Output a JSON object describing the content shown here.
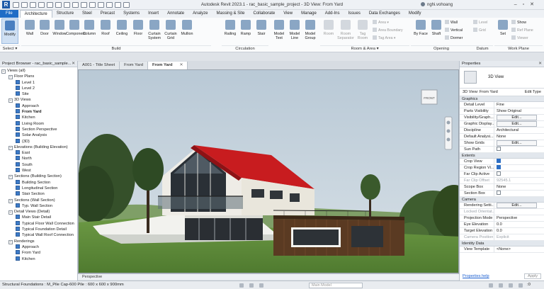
{
  "app_title": "Autodesk Revit 2023.1 - rac_basic_sample_project - 3D View: From Yard",
  "user_name": "nghi.vohoang",
  "ribbon_tabs": [
    "File",
    "Architecture",
    "Structure",
    "Steel",
    "Precast",
    "Systems",
    "Insert",
    "Annotate",
    "Analyze",
    "Massing & Site",
    "Collaborate",
    "View",
    "Manage",
    "Add-Ins",
    "Issues",
    "Data Exchanges",
    "Modify"
  ],
  "active_tab": "Architecture",
  "ribbon": {
    "select": {
      "modify": "Modify",
      "label": "Select ▾"
    },
    "build_buttons": [
      "Wall",
      "Door",
      "Window",
      "Component",
      "Column",
      "Roof",
      "Ceiling",
      "Floor",
      "Curtain System",
      "Curtain Grid",
      "Mullion"
    ],
    "build_label": "Build",
    "circulation_buttons": [
      "Railing",
      "Ramp",
      "Stair"
    ],
    "circulation_label": "Circulation",
    "model_buttons": [
      "Model Text",
      "Model Line",
      "Model Group"
    ],
    "room_buttons": [
      "Room",
      "Room Separator",
      "Tag Room"
    ],
    "area_items": [
      "Area ▾",
      "Area Boundary",
      "Tag Area ▾"
    ],
    "room_label": "Room & Area ▾",
    "opening_buttons": [
      "By Face",
      "Shaft"
    ],
    "opening_small": [
      "Wall",
      "Vertical",
      "Dormer"
    ],
    "opening_label": "Opening",
    "datum_items": [
      "Level",
      "Grid"
    ],
    "datum_label": "Datum",
    "workplane_buttons": [
      "Set"
    ],
    "workplane_small": [
      "Show",
      "Ref Plane",
      "Viewer"
    ],
    "workplane_label": "Work Plane"
  },
  "project_browser": {
    "title": "Project Browser - rac_basic_sample...",
    "rows": [
      {
        "indent": 0,
        "toggle": "−",
        "icon": false,
        "text": "Views (all)"
      },
      {
        "indent": 1,
        "toggle": "−",
        "icon": false,
        "text": "Floor Plans"
      },
      {
        "indent": 2,
        "toggle": "",
        "icon": true,
        "text": "Level 1"
      },
      {
        "indent": 2,
        "toggle": "",
        "icon": true,
        "text": "Level 2"
      },
      {
        "indent": 2,
        "toggle": "",
        "icon": true,
        "text": "Site"
      },
      {
        "indent": 1,
        "toggle": "−",
        "icon": false,
        "text": "3D Views"
      },
      {
        "indent": 2,
        "toggle": "",
        "icon": true,
        "text": "Approach"
      },
      {
        "indent": 2,
        "toggle": "",
        "icon": true,
        "text": "From Yard",
        "bold": true
      },
      {
        "indent": 2,
        "toggle": "",
        "icon": true,
        "text": "Kitchen"
      },
      {
        "indent": 2,
        "toggle": "",
        "icon": true,
        "text": "Living Room"
      },
      {
        "indent": 2,
        "toggle": "",
        "icon": true,
        "text": "Section Perspective"
      },
      {
        "indent": 2,
        "toggle": "",
        "icon": true,
        "text": "Solar Analysis"
      },
      {
        "indent": 2,
        "toggle": "",
        "icon": true,
        "text": "{3D}"
      },
      {
        "indent": 1,
        "toggle": "−",
        "icon": false,
        "text": "Elevations (Building Elevation)"
      },
      {
        "indent": 2,
        "toggle": "",
        "icon": true,
        "text": "East"
      },
      {
        "indent": 2,
        "toggle": "",
        "icon": true,
        "text": "North"
      },
      {
        "indent": 2,
        "toggle": "",
        "icon": true,
        "text": "South"
      },
      {
        "indent": 2,
        "toggle": "",
        "icon": true,
        "text": "West"
      },
      {
        "indent": 1,
        "toggle": "−",
        "icon": false,
        "text": "Sections (Building Section)"
      },
      {
        "indent": 2,
        "toggle": "",
        "icon": true,
        "text": "Building Section"
      },
      {
        "indent": 2,
        "toggle": "",
        "icon": true,
        "text": "Longitudinal Section"
      },
      {
        "indent": 2,
        "toggle": "",
        "icon": true,
        "text": "Stair Section"
      },
      {
        "indent": 1,
        "toggle": "−",
        "icon": false,
        "text": "Sections (Wall Section)"
      },
      {
        "indent": 2,
        "toggle": "",
        "icon": true,
        "text": "Typ. Wall Section"
      },
      {
        "indent": 1,
        "toggle": "−",
        "icon": false,
        "text": "Detail Views (Detail)"
      },
      {
        "indent": 2,
        "toggle": "",
        "icon": true,
        "text": "Main Stair Detail"
      },
      {
        "indent": 2,
        "toggle": "",
        "icon": true,
        "text": "Typical Floor Wall Connection"
      },
      {
        "indent": 2,
        "toggle": "",
        "icon": true,
        "text": "Typical Foundation Detail"
      },
      {
        "indent": 2,
        "toggle": "",
        "icon": true,
        "text": "Typical Wall Roof Connection"
      },
      {
        "indent": 1,
        "toggle": "−",
        "icon": false,
        "text": "Renderings"
      },
      {
        "indent": 2,
        "toggle": "",
        "icon": true,
        "text": "Approach"
      },
      {
        "indent": 2,
        "toggle": "",
        "icon": true,
        "text": "From Yard"
      },
      {
        "indent": 2,
        "toggle": "",
        "icon": true,
        "text": "Kitchen"
      }
    ]
  },
  "doc_tabs": [
    {
      "label": "A001 - Title Sheet",
      "active": false
    },
    {
      "label": "From Yard",
      "active": false
    },
    {
      "label": "From Yard",
      "active": true
    }
  ],
  "viewcube_label": "FRONT",
  "view_control_bar": {
    "mode": "Perspective"
  },
  "properties": {
    "title": "Properties",
    "type_name": "3D View",
    "selector": "3D View: From Yard",
    "edit_type": "Edit Type",
    "groups": [
      {
        "name": "Graphics",
        "rows": [
          {
            "k": "Detail Level",
            "v": "Fine",
            "kind": "text"
          },
          {
            "k": "Parts Visibility",
            "v": "Show Original",
            "kind": "text"
          },
          {
            "k": "Visibility/Graph...",
            "v": "Edit...",
            "kind": "btn"
          },
          {
            "k": "Graphic Display...",
            "v": "Edit...",
            "kind": "btn"
          },
          {
            "k": "Discipline",
            "v": "Architectural",
            "kind": "text"
          },
          {
            "k": "Default Analysi...",
            "v": "None",
            "kind": "text"
          },
          {
            "k": "Show Grids",
            "v": "Edit...",
            "kind": "btn"
          },
          {
            "k": "Sun Path",
            "v": "",
            "kind": "chk"
          }
        ]
      },
      {
        "name": "Extents",
        "rows": [
          {
            "k": "Crop View",
            "v": "",
            "kind": "chkon"
          },
          {
            "k": "Crop Region Vi...",
            "v": "",
            "kind": "chkon"
          },
          {
            "k": "Far Clip Active",
            "v": "",
            "kind": "chk"
          },
          {
            "k": "Far Clip Offset",
            "v": "92545.1",
            "kind": "text",
            "dis": true
          },
          {
            "k": "Scope Box",
            "v": "None",
            "kind": "text"
          },
          {
            "k": "Section Box",
            "v": "",
            "kind": "chk"
          }
        ]
      },
      {
        "name": "Camera",
        "rows": [
          {
            "k": "Rendering Setti...",
            "v": "Edit...",
            "kind": "btn"
          },
          {
            "k": "Locked Orientat...",
            "v": "",
            "kind": "text",
            "dis": true
          },
          {
            "k": "Projection Mode",
            "v": "Perspective",
            "kind": "text"
          },
          {
            "k": "Eye Elevation",
            "v": "0.0",
            "kind": "text"
          },
          {
            "k": "Target Elevation",
            "v": "0.0",
            "kind": "text"
          },
          {
            "k": "Camera Position",
            "v": "Explicit",
            "kind": "text",
            "dis": true
          }
        ]
      },
      {
        "name": "Identity Data",
        "rows": [
          {
            "k": "View Template",
            "v": "<None>",
            "kind": "text"
          }
        ]
      }
    ],
    "help_link": "Properties help",
    "apply_label": "Apply"
  },
  "status": {
    "text": "Structural Foundations : M_Pile Cap-600 Pile : 600 x 600 x 900mm",
    "model": "Main Model",
    "selection_count": ":0"
  },
  "colors": {
    "file_tab": "#1f6cc6",
    "roof": "#c81c1f",
    "sky": "#c8d4de",
    "grass": "#5c8a3a",
    "siding": "#5a3a22"
  }
}
